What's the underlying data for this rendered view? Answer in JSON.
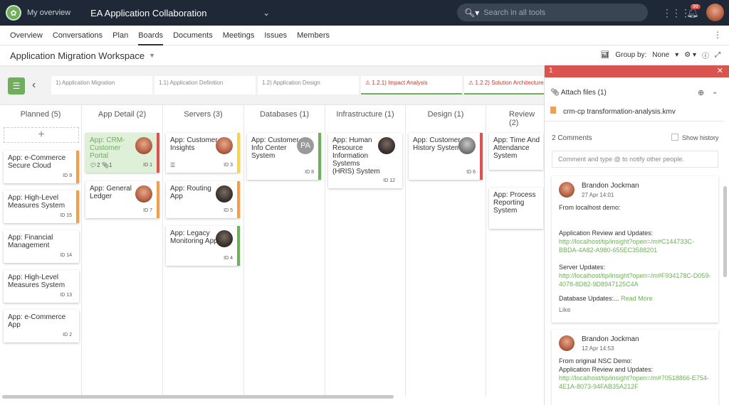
{
  "topbar": {
    "my_overview": "My overview",
    "workspace": "EA Application Collaboration",
    "search_placeholder": "Search in all tools",
    "notif_count": "99"
  },
  "subnav": {
    "tabs": [
      "Overview",
      "Conversations",
      "Plan",
      "Boards",
      "Documents",
      "Meetings",
      "Issues",
      "Members"
    ],
    "active": "Boards"
  },
  "header": {
    "title": "Application Migration Workspace",
    "group_by_label": "Group by:",
    "group_by_value": "None"
  },
  "breadcrumb": {
    "steps": [
      "1) Application Migration",
      "1.1) Application Definition",
      "1.2) Application Design",
      "1.2.1) Impact Analysis",
      "1.2.2) Solution Architecture"
    ]
  },
  "columns": [
    {
      "title": "Planned (5)"
    },
    {
      "title": "App Detail (2)"
    },
    {
      "title": "Servers (3)"
    },
    {
      "title": "Databases (1)"
    },
    {
      "title": "Infrastructure (1)"
    },
    {
      "title": "Design (1)"
    },
    {
      "title": "Review (2)"
    }
  ],
  "cards": {
    "planned": [
      {
        "title": "App: e-Commerce Secure Cloud",
        "id": "ID 9"
      },
      {
        "title": "App: High-Level Measures System",
        "id": "ID 15"
      },
      {
        "title": "App: Financial Management",
        "id": "ID 14"
      },
      {
        "title": "App: High-Level Measures System",
        "id": "ID 13"
      },
      {
        "title": "App: e-Commerce App",
        "id": "ID 2"
      }
    ],
    "appdetail": [
      {
        "title": "App: CRM-Customer Portal",
        "id": "ID 1",
        "comments": "2",
        "attachments": "1"
      },
      {
        "title": "App: General Ledger",
        "id": "ID 7"
      }
    ],
    "servers": [
      {
        "title": "App: Customer Insights",
        "id": "ID 3"
      },
      {
        "title": "App: Routing App",
        "id": "ID 5"
      },
      {
        "title": "App: Legacy Monitoring App",
        "id": "ID 4"
      }
    ],
    "databases": [
      {
        "title": "App: Customer Info Center System",
        "id": "ID 8",
        "avatar": "PA"
      }
    ],
    "infrastructure": [
      {
        "title": "App: Human Resource Information Systems (HRIS) System",
        "id": "ID 12"
      }
    ],
    "design": [
      {
        "title": "App: Customer History System",
        "id": "ID 6"
      }
    ],
    "review": [
      {
        "title": "App: Time And Attendance System"
      },
      {
        "title": "App: Process Reporting System"
      }
    ]
  },
  "colors": {
    "accent": "#6fae5b",
    "red": "#d9534f",
    "orange": "#f0a04b",
    "yellow": "#f5d54a",
    "green": "#6fae5b"
  },
  "panel": {
    "header": "1",
    "attach_label": "Attach files (1)",
    "file_name": "crm-cp transformation-analysis.kmv",
    "comments_count": "2 Comments",
    "show_history": "Show history",
    "input_placeholder": "Comment and type @ to notify other people.",
    "comments": [
      {
        "author": "Brandon Jockman",
        "date": "27 Apr 14:01",
        "line1": "From localhost demo:",
        "line2": "Application Review and Updates:",
        "link1": "http://localhost/tip/insight?open=/m#C144733C-BBDA-4A82-A980-655EC3588201",
        "line3": "Server Updates:",
        "link2": "http://localhost/tip/insight?open=/m#F934178C-D059-4078-8D82-9D8947125C4A",
        "line4": "Database Updates:...",
        "read_more": "Read More",
        "like": "Like"
      },
      {
        "author": "Brandon Jockman",
        "date": "12 Apr 14:53",
        "line1": "From original NSC Demo:",
        "line2": "Application Review and Updates:",
        "link1": "http://localhost/tip/insight?open=/m#70518866-E754-4E1A-8073-94FAB35A212F"
      }
    ]
  }
}
